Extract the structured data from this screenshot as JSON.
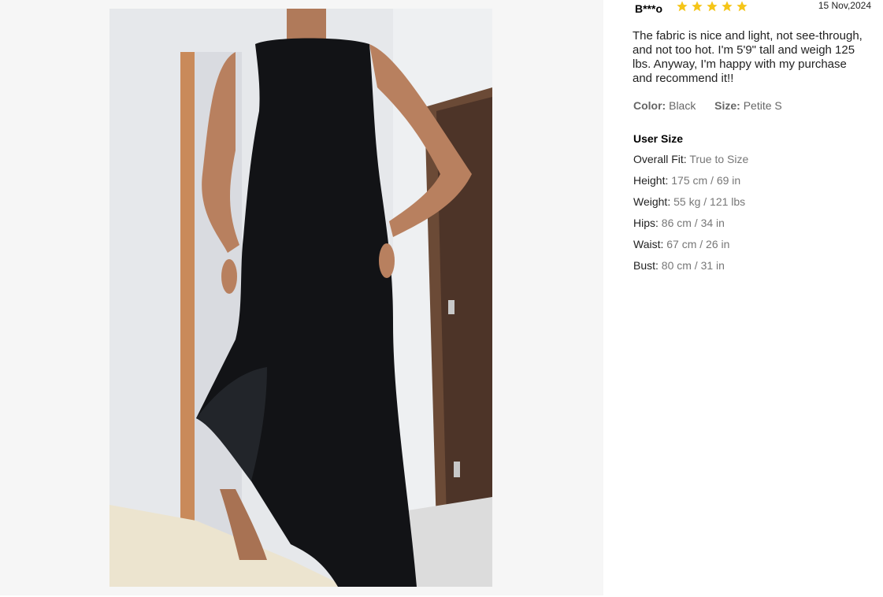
{
  "review": {
    "reviewer": "B***o",
    "rating": 5,
    "date": "15 Nov,2024",
    "text": "The fabric is nice and light, not see-through, and not too hot. I'm 5'9\" tall and weigh 125 lbs. Anyway, I'm happy with my purchase and recommend it!!",
    "color_label": "Color:",
    "color_value": "Black",
    "size_label": "Size:",
    "size_value": "Petite S"
  },
  "user_size": {
    "title": "User Size",
    "rows": [
      {
        "label": "Overall Fit:",
        "value": "True to Size"
      },
      {
        "label": "Height:",
        "value": "175 cm / 69 in"
      },
      {
        "label": "Weight:",
        "value": "55 kg / 121 lbs"
      },
      {
        "label": "Hips:",
        "value": "86 cm / 34 in"
      },
      {
        "label": "Waist:",
        "value": "67 cm / 26 in"
      },
      {
        "label": "Bust:",
        "value": "80 cm / 31 in"
      }
    ]
  },
  "colors": {
    "star": "#f5c518",
    "panel_bg": "#f6f6f6"
  }
}
